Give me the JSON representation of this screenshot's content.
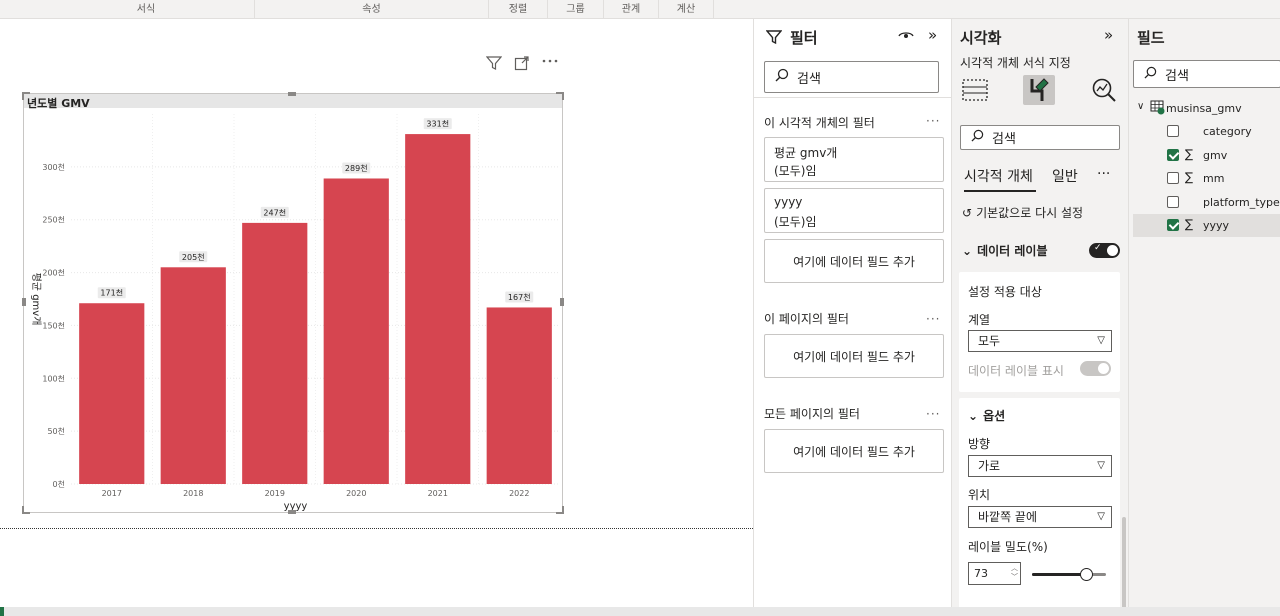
{
  "ribbon": {
    "groups": [
      "서식",
      "속성",
      "정렬",
      "그룹",
      "관계",
      "계산"
    ]
  },
  "visual": {
    "title": "년도별 GMV"
  },
  "chart_data": {
    "type": "bar",
    "title": "년도별 GMV",
    "xlabel": "yyyy",
    "ylabel": "평균 gmv개",
    "categories": [
      "2017",
      "2018",
      "2019",
      "2020",
      "2021",
      "2022"
    ],
    "values": [
      171000,
      205000,
      247000,
      289000,
      331000,
      167000
    ],
    "data_labels": [
      "171천",
      "205천",
      "247천",
      "289천",
      "331천",
      "167천"
    ],
    "yticks": [
      0,
      50000,
      100000,
      150000,
      200000,
      250000,
      300000
    ],
    "ytick_labels": [
      "0천",
      "50천",
      "100천",
      "150천",
      "200천",
      "250천",
      "300천"
    ],
    "ylim": [
      0,
      350000
    ],
    "bar_color": "#d64550",
    "grid": true
  },
  "filters": {
    "title": "필터",
    "search_placeholder": "검색",
    "visual_filters_head": "이 시각적 개체의 필터",
    "visual_filter_cards": [
      {
        "line1": "평균 gmv개",
        "line2": "(모두)임"
      },
      {
        "line1": "yyyy",
        "line2": "(모두)임"
      }
    ],
    "add_field": "여기에 데이터 필드 추가",
    "page_filters_head": "이 페이지의 필터",
    "all_pages_head": "모든 페이지의 필터",
    "more": "···"
  },
  "viz": {
    "title": "시각화",
    "subtitle": "시각적 개체 서식 지정",
    "search_placeholder": "검색",
    "tab_visual": "시각적 개체",
    "tab_general": "일반",
    "more": "···",
    "reset": "기본값으로 다시 설정",
    "data_labels_head": "데이터 레이블",
    "apply_to_head": "설정 적용 대상",
    "series_label": "계열",
    "series_value": "모두",
    "show_labels": "데이터 레이블 표시",
    "options_head": "옵션",
    "direction_label": "방향",
    "direction_value": "가로",
    "position_label": "위치",
    "position_value": "바깥쪽 끝에",
    "density_label": "레이블 밀도(%)",
    "density_value": "73",
    "density_fraction": 0.73
  },
  "fields": {
    "title": "필드",
    "search_placeholder": "검색",
    "table_name": "musinsa_gmv",
    "items": [
      {
        "name": "category",
        "sigma": false,
        "checked": false
      },
      {
        "name": "gmv",
        "sigma": true,
        "checked": true
      },
      {
        "name": "mm",
        "sigma": true,
        "checked": false
      },
      {
        "name": "platform_type",
        "sigma": false,
        "checked": false
      },
      {
        "name": "yyyy",
        "sigma": true,
        "checked": true
      }
    ]
  },
  "colors": {
    "accent_green": "#217346",
    "bar": "#d64550"
  }
}
